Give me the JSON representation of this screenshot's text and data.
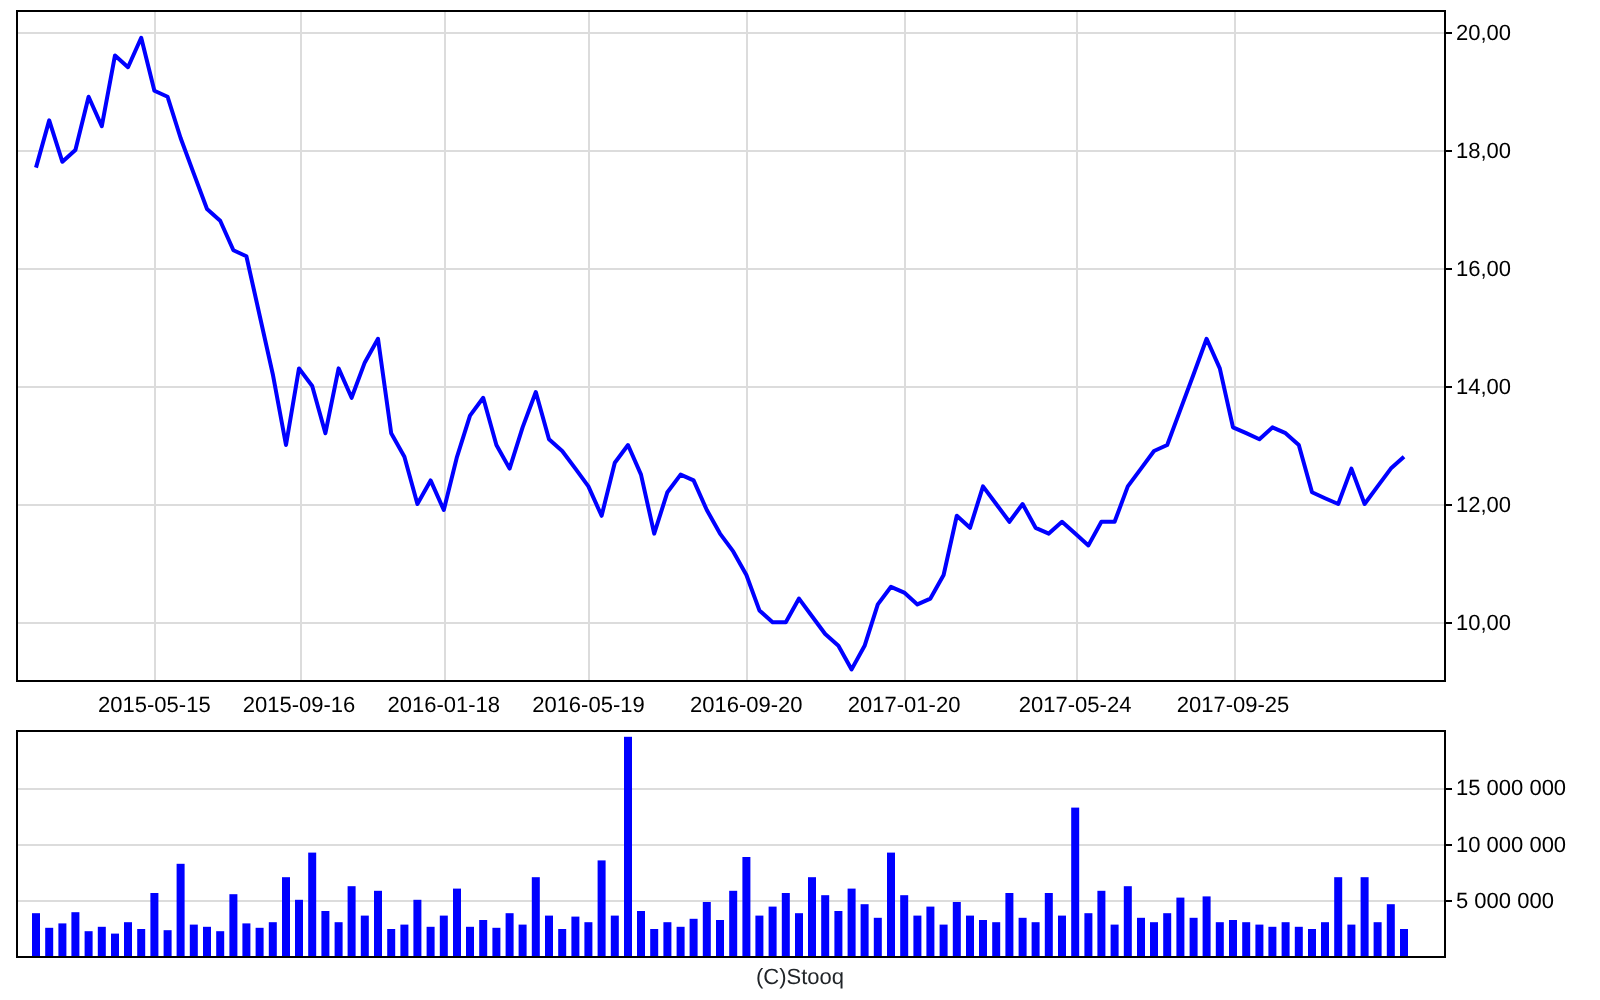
{
  "price_chart": {
    "chart_data": {
      "type": "line",
      "grid": true,
      "categories": [
        null,
        null,
        null,
        null,
        null,
        null,
        null,
        null,
        null,
        "2015-05-15",
        null,
        null,
        null,
        null,
        null,
        null,
        null,
        null,
        null,
        null,
        "2015-09-16",
        null,
        null,
        null,
        null,
        null,
        null,
        null,
        null,
        null,
        null,
        "2016-01-18",
        null,
        null,
        null,
        null,
        null,
        null,
        null,
        null,
        null,
        null,
        "2016-05-19",
        null,
        null,
        null,
        null,
        null,
        null,
        null,
        null,
        null,
        null,
        null,
        "2016-09-20",
        null,
        null,
        null,
        null,
        null,
        null,
        null,
        null,
        null,
        null,
        null,
        "2017-01-20",
        null,
        null,
        null,
        null,
        null,
        null,
        null,
        null,
        null,
        null,
        null,
        null,
        "2017-05-24",
        null,
        null,
        null,
        null,
        null,
        null,
        null,
        null,
        null,
        null,
        null,
        "2017-09-25",
        null,
        null,
        null,
        null,
        null,
        null,
        null,
        null,
        null,
        null,
        null,
        null,
        null
      ],
      "yticks": [
        {
          "value": 10,
          "label": "10,00"
        },
        {
          "value": 12,
          "label": "12,00"
        },
        {
          "value": 14,
          "label": "14,00"
        },
        {
          "value": 16,
          "label": "16,00"
        },
        {
          "value": 18,
          "label": "18,00"
        },
        {
          "value": 20,
          "label": "20,00"
        }
      ],
      "ylim": [
        9.02,
        20.37
      ],
      "series": [
        {
          "color": "#0000ff",
          "values": [
            17.7,
            18.5,
            17.8,
            18.0,
            18.9,
            18.4,
            19.6,
            19.4,
            19.9,
            19.0,
            18.9,
            18.2,
            17.6,
            17.0,
            16.8,
            16.3,
            16.2,
            15.2,
            14.2,
            13.0,
            14.3,
            14.0,
            13.2,
            14.3,
            13.8,
            14.4,
            14.8,
            13.2,
            12.8,
            12.0,
            12.4,
            11.9,
            12.8,
            13.5,
            13.8,
            13.0,
            12.6,
            13.3,
            13.9,
            13.1,
            12.9,
            12.6,
            12.3,
            11.8,
            12.7,
            13.0,
            12.5,
            11.5,
            12.2,
            12.5,
            12.4,
            11.9,
            11.5,
            11.2,
            10.8,
            10.2,
            10.0,
            10.0,
            10.4,
            10.1,
            9.8,
            9.6,
            9.2,
            9.6,
            10.3,
            10.6,
            10.5,
            10.3,
            10.4,
            10.8,
            11.8,
            11.6,
            12.3,
            12.0,
            11.7,
            12.0,
            11.6,
            11.5,
            11.7,
            11.5,
            11.3,
            11.7,
            11.7,
            12.3,
            12.6,
            12.9,
            13.0,
            13.6,
            14.2,
            14.8,
            14.3,
            13.3,
            13.2,
            13.1,
            13.3,
            13.2,
            13.0,
            12.2,
            12.1,
            12.0,
            12.6,
            12.0,
            12.3,
            12.6,
            12.8
          ]
        }
      ]
    }
  },
  "volume_chart": {
    "chart_data": {
      "type": "bar",
      "grid": true,
      "yticks": [
        {
          "value": 5000000,
          "label": "5 000 000"
        },
        {
          "value": 10000000,
          "label": "10 000 000"
        },
        {
          "value": 15000000,
          "label": "15 000 000"
        }
      ],
      "ylim": [
        0,
        20100000
      ],
      "series": [
        {
          "color": "#0000ff",
          "values": [
            3800000,
            2500000,
            2900000,
            3900000,
            2200000,
            2600000,
            2000000,
            3000000,
            2400000,
            5600000,
            2300000,
            8200000,
            2800000,
            2600000,
            2200000,
            5500000,
            2900000,
            2500000,
            3000000,
            7000000,
            5000000,
            9200000,
            4000000,
            3000000,
            6200000,
            3600000,
            5800000,
            2400000,
            2800000,
            5000000,
            2600000,
            3600000,
            6000000,
            2600000,
            3200000,
            2500000,
            3800000,
            2800000,
            7000000,
            3600000,
            2400000,
            3500000,
            3000000,
            8500000,
            3600000,
            19500000,
            4000000,
            2400000,
            3000000,
            2600000,
            3300000,
            4800000,
            3200000,
            5800000,
            8800000,
            3600000,
            4400000,
            5600000,
            3800000,
            7000000,
            5400000,
            4000000,
            6000000,
            4600000,
            3400000,
            9200000,
            5400000,
            3600000,
            4400000,
            2800000,
            4800000,
            3600000,
            3200000,
            3000000,
            5600000,
            3400000,
            3000000,
            5600000,
            3600000,
            13200000,
            3800000,
            5800000,
            2800000,
            6200000,
            3400000,
            3000000,
            3800000,
            5200000,
            3400000,
            5300000,
            3000000,
            3200000,
            3000000,
            2800000,
            2600000,
            3000000,
            2600000,
            2400000,
            3000000,
            7000000,
            2800000,
            7000000,
            3000000,
            4600000,
            2400000
          ]
        }
      ]
    }
  },
  "credit": "(C)Stooq"
}
